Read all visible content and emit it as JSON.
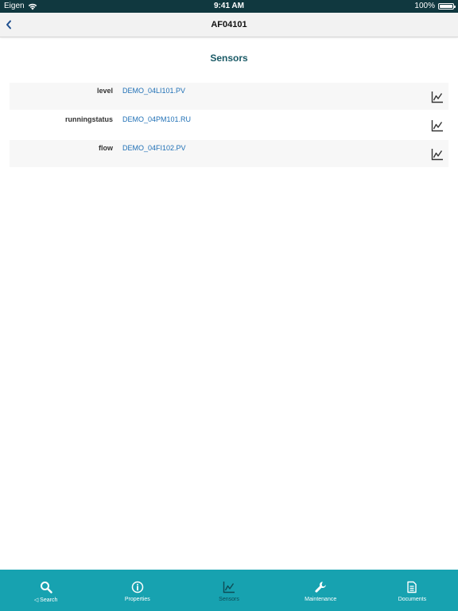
{
  "status_bar": {
    "carrier": "Eigen",
    "time": "9:41 AM",
    "battery": "100%"
  },
  "nav": {
    "title": "AF04101",
    "back_icon": "chevron-left-icon"
  },
  "section": {
    "title": "Sensors"
  },
  "sensors": [
    {
      "label": "level",
      "tag": "DEMO_04LI101.PV",
      "icon": "line-chart-icon"
    },
    {
      "label": "runningstatus",
      "tag": "DEMO_04PM101.RU",
      "icon": "line-chart-icon"
    },
    {
      "label": "flow",
      "tag": "DEMO_04FI102.PV",
      "icon": "line-chart-icon"
    }
  ],
  "tabs": [
    {
      "label": "Search",
      "icon": "search-icon",
      "prefix": "◁"
    },
    {
      "label": "Properties",
      "icon": "info-icon"
    },
    {
      "label": "Sensors",
      "icon": "line-chart-icon",
      "active": true
    },
    {
      "label": "Maintenance",
      "icon": "wrench-icon"
    },
    {
      "label": "Documents",
      "icon": "document-icon"
    }
  ],
  "colors": {
    "status_bar": "#10383f",
    "tab_bar": "#17a2b0",
    "link": "#1e6fb5",
    "section_title": "#1a5a66"
  }
}
